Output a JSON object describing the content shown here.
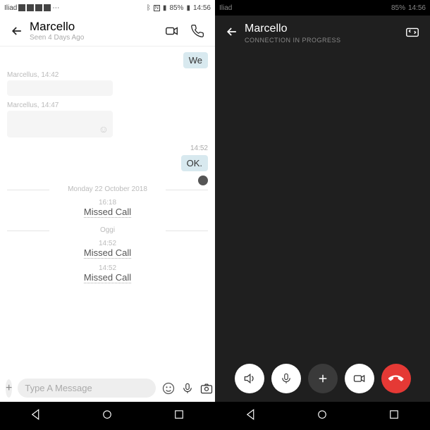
{
  "status": {
    "carrier": "Iliad",
    "battery": "85%",
    "time": "14:56"
  },
  "left": {
    "header": {
      "name": "Marcello",
      "sub": "Seen 4 Days Ago"
    },
    "msg_out1": "We",
    "meta1": "Marcellus, 14:42",
    "meta2": "Marcellus, 14:47",
    "time_ok": "14:52",
    "msg_ok": "OK.",
    "date_sep": "Monday 22 October 2018",
    "oggi": "Oggi",
    "calls": [
      {
        "time": "16:18",
        "label": "Missed Call"
      },
      {
        "time": "14:52",
        "label": "Missed Call"
      },
      {
        "time": "14:52",
        "label": "Missed Call"
      }
    ],
    "compose": {
      "placeholder": "Type A Message"
    }
  },
  "right": {
    "header": {
      "name": "Marcello",
      "sub": "CONNECTION IN PROGRESS"
    }
  }
}
